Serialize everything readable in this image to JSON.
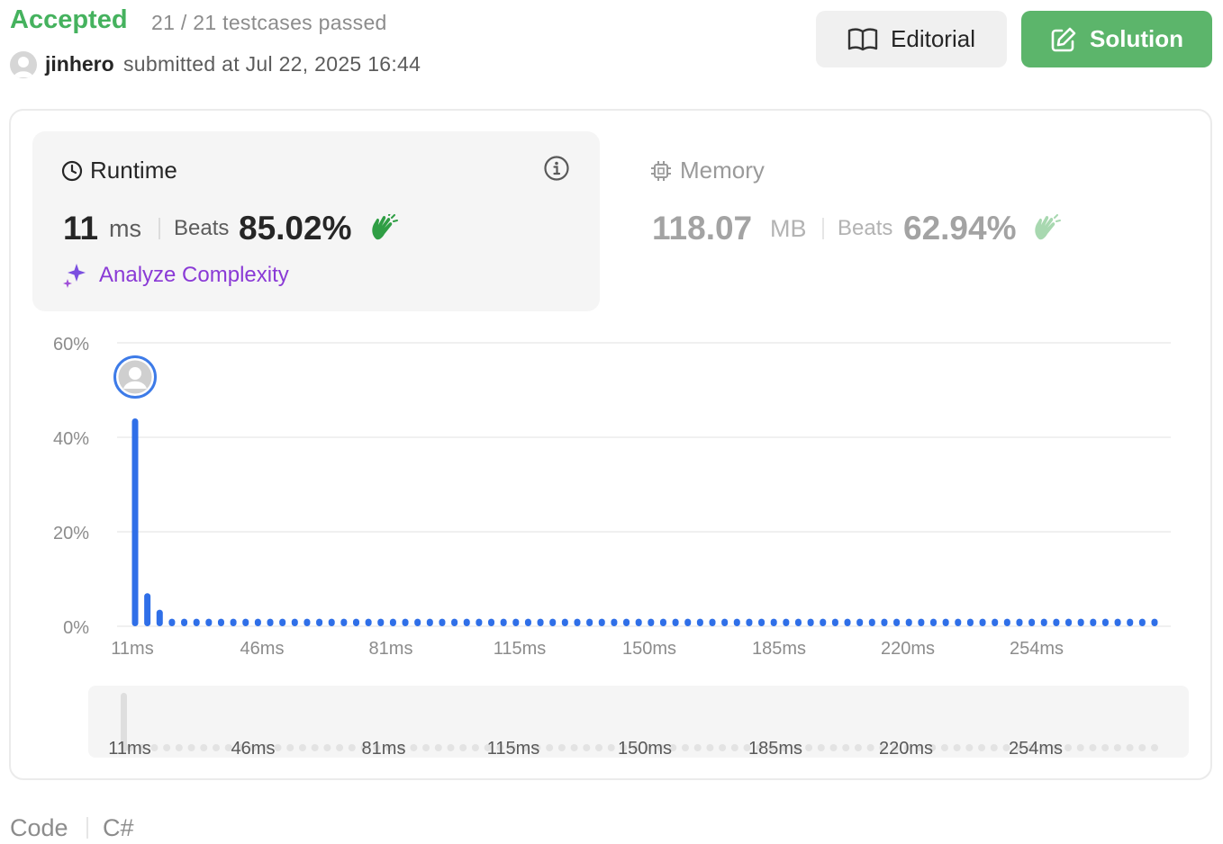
{
  "header": {
    "status": "Accepted",
    "testcases": "21 / 21 testcases passed",
    "username": "jinhero",
    "submitted": "submitted at Jul 22, 2025 16:44",
    "editorial_label": "Editorial",
    "solution_label": "Solution"
  },
  "runtime": {
    "title": "Runtime",
    "value": "11",
    "unit": "ms",
    "beats_label": "Beats",
    "beats": "85.02%",
    "analyze_label": "Analyze Complexity"
  },
  "memory": {
    "title": "Memory",
    "value": "118.07",
    "unit": "MB",
    "beats_label": "Beats",
    "beats": "62.94%"
  },
  "code": {
    "label": "Code",
    "language": "C#"
  },
  "colors": {
    "accepted": "#45b25e",
    "solution_button": "#5cb56b",
    "bar": "#2f6fe8",
    "analyze": "#8a3ad6"
  },
  "chart_data": {
    "type": "bar",
    "title": "",
    "xlabel": "",
    "ylabel": "",
    "ylim": [
      0,
      60
    ],
    "yticks": [
      "60%",
      "40%",
      "20%",
      "0%"
    ],
    "xticks": [
      "11ms",
      "46ms",
      "81ms",
      "115ms",
      "150ms",
      "185ms",
      "220ms",
      "254ms"
    ],
    "highlight_index": 0,
    "values": [
      44,
      7,
      3.5,
      1.6,
      1.6,
      1.6,
      1.6,
      1.6,
      1.6,
      1.6,
      1.6,
      1.6,
      1.6,
      1.6,
      1.6,
      1.6,
      1.6,
      1.6,
      1.6,
      1.6,
      1.6,
      1.6,
      1.6,
      1.6,
      1.6,
      1.6,
      1.6,
      1.6,
      1.6,
      1.6,
      1.6,
      1.6,
      1.6,
      1.6,
      1.6,
      1.6,
      1.6,
      1.6,
      1.6,
      1.6,
      1.6,
      1.6,
      1.6,
      1.6,
      1.6,
      1.6,
      1.6,
      1.6,
      1.6,
      1.6,
      1.6,
      1.6,
      1.6,
      1.6,
      1.6,
      1.6,
      1.6,
      1.6,
      1.6,
      1.6,
      1.6,
      1.6,
      1.6,
      1.6,
      1.6,
      1.6,
      1.6,
      1.6,
      1.6,
      1.6,
      1.6,
      1.6,
      1.6,
      1.6,
      1.6,
      1.6,
      1.6,
      1.6,
      1.6,
      1.6,
      1.6,
      1.6,
      1.6,
      1.6
    ]
  }
}
